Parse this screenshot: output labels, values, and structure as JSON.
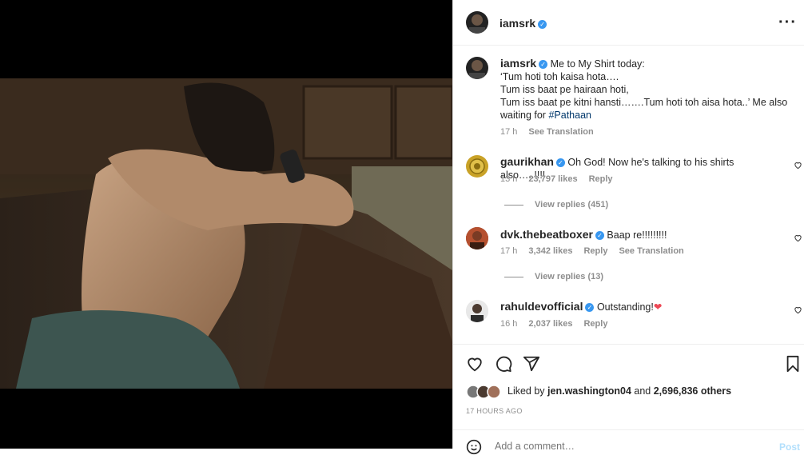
{
  "post": {
    "author": "iamsrk",
    "more_icon": "more-horizontal-icon"
  },
  "caption": {
    "author": "iamsrk",
    "line1": "Me to My Shirt today:",
    "line2": "‘Tum hoti toh kaisa hota….",
    "line3": "Tum iss baat pe hairaan hoti,",
    "line4": "Tum iss baat pe kitni hansti…….Tum hoti toh aisa hota..’ Me also",
    "line5_prefix": "waiting for ",
    "hashtag": "#Pathaan",
    "time": "17 h",
    "translate": "See Translation"
  },
  "comments": [
    {
      "author": "gaurikhan",
      "text": "Oh God! Now he's talking to his shirts also…..!!!!",
      "time": "13 h",
      "likes": "23,797 likes",
      "reply": "Reply",
      "view_replies": "View replies (451)"
    },
    {
      "author": "dvk.thebeatboxer",
      "text": "Baap re!!!!!!!!!",
      "time": "17 h",
      "likes": "3,342 likes",
      "reply": "Reply",
      "translate": "See Translation",
      "view_replies": "View replies (13)"
    },
    {
      "author": "rahuldevofficial",
      "text": "Outstanding!",
      "emoji": "❤",
      "time": "16 h",
      "likes": "2,037 likes",
      "reply": "Reply"
    }
  ],
  "likes_line": {
    "prefix": "Liked by ",
    "user": "jen.washington04",
    "middle": " and ",
    "count": "2,696,836 others"
  },
  "timestamp": "17 HOURS AGO",
  "add_comment": {
    "placeholder": "Add a comment…",
    "post_label": "Post"
  },
  "colors": {
    "verified": "#3897f0",
    "link": "#00376b",
    "muted": "#8e8e8e",
    "heart": "#ed4956"
  }
}
